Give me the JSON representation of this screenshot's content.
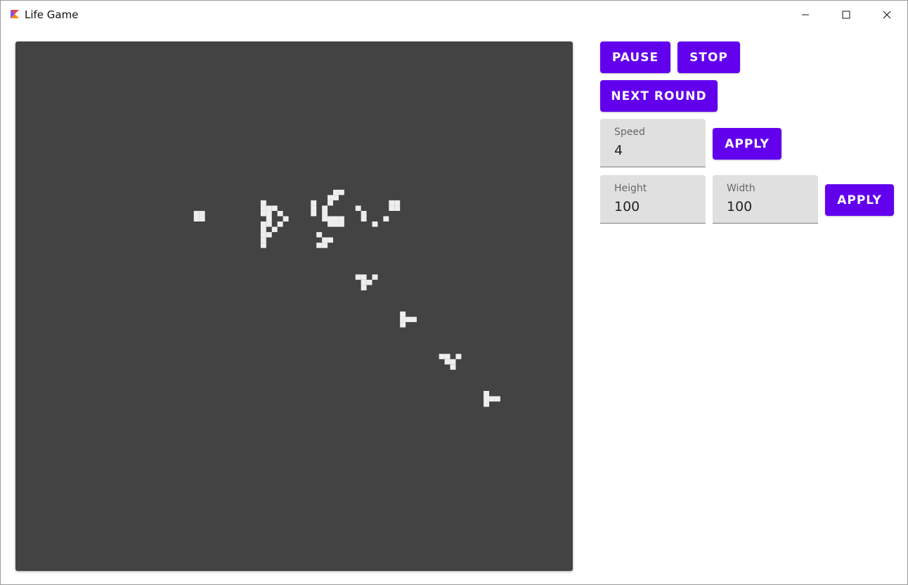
{
  "window": {
    "title": "Life Game",
    "controls": [
      "minimize-icon",
      "maximize-icon",
      "close-icon"
    ]
  },
  "colors": {
    "board": "#434343",
    "live_cell": "#eeeeee",
    "accent": "#6200ee",
    "field_bg": "#e0e0e0"
  },
  "controls": {
    "pause_label": "PAUSE",
    "stop_label": "STOP",
    "next_round_label": "NEXT ROUND",
    "speed": {
      "label": "Speed",
      "value": "4"
    },
    "speed_apply_label": "APPLY",
    "height": {
      "label": "Height",
      "value": "100"
    },
    "width": {
      "label": "Width",
      "value": "100"
    },
    "size_apply_label": "APPLY"
  },
  "grid": {
    "rows": 100,
    "cols": 100,
    "live_cells": [
      [
        32,
        32
      ],
      [
        32,
        33
      ],
      [
        33,
        32
      ],
      [
        33,
        33
      ],
      [
        30,
        44
      ],
      [
        31,
        44
      ],
      [
        32,
        44
      ],
      [
        31,
        45
      ],
      [
        32,
        45
      ],
      [
        33,
        45
      ],
      [
        34,
        44
      ],
      [
        35,
        44
      ],
      [
        34,
        45
      ],
      [
        36,
        44
      ],
      [
        36,
        45
      ],
      [
        37,
        44
      ],
      [
        38,
        44
      ],
      [
        31,
        46
      ],
      [
        32,
        47
      ],
      [
        33,
        48
      ],
      [
        34,
        47
      ],
      [
        35,
        46
      ],
      [
        30,
        53
      ],
      [
        31,
        53
      ],
      [
        32,
        53
      ],
      [
        31,
        55
      ],
      [
        32,
        55
      ],
      [
        30,
        56
      ],
      [
        29,
        56
      ],
      [
        29,
        57
      ],
      [
        28,
        57
      ],
      [
        28,
        58
      ],
      [
        33,
        55
      ],
      [
        33,
        56
      ],
      [
        34,
        56
      ],
      [
        34,
        57
      ],
      [
        34,
        58
      ],
      [
        33,
        57
      ],
      [
        33,
        58
      ],
      [
        31,
        61
      ],
      [
        32,
        62
      ],
      [
        33,
        62
      ],
      [
        34,
        64
      ],
      [
        33,
        66
      ],
      [
        31,
        67
      ],
      [
        30,
        67
      ],
      [
        30,
        68
      ],
      [
        31,
        68
      ],
      [
        36,
        54
      ],
      [
        37,
        55
      ],
      [
        37,
        56
      ],
      [
        38,
        54
      ],
      [
        38,
        55
      ],
      [
        44,
        61
      ],
      [
        44,
        62
      ],
      [
        45,
        62
      ],
      [
        45,
        63
      ],
      [
        44,
        64
      ],
      [
        46,
        62
      ],
      [
        51,
        69
      ],
      [
        52,
        69
      ],
      [
        52,
        70
      ],
      [
        52,
        71
      ],
      [
        53,
        69
      ],
      [
        59,
        76
      ],
      [
        59,
        77
      ],
      [
        60,
        77
      ],
      [
        60,
        78
      ],
      [
        59,
        79
      ],
      [
        61,
        78
      ],
      [
        66,
        84
      ],
      [
        67,
        84
      ],
      [
        67,
        85
      ],
      [
        67,
        86
      ],
      [
        68,
        84
      ]
    ]
  }
}
